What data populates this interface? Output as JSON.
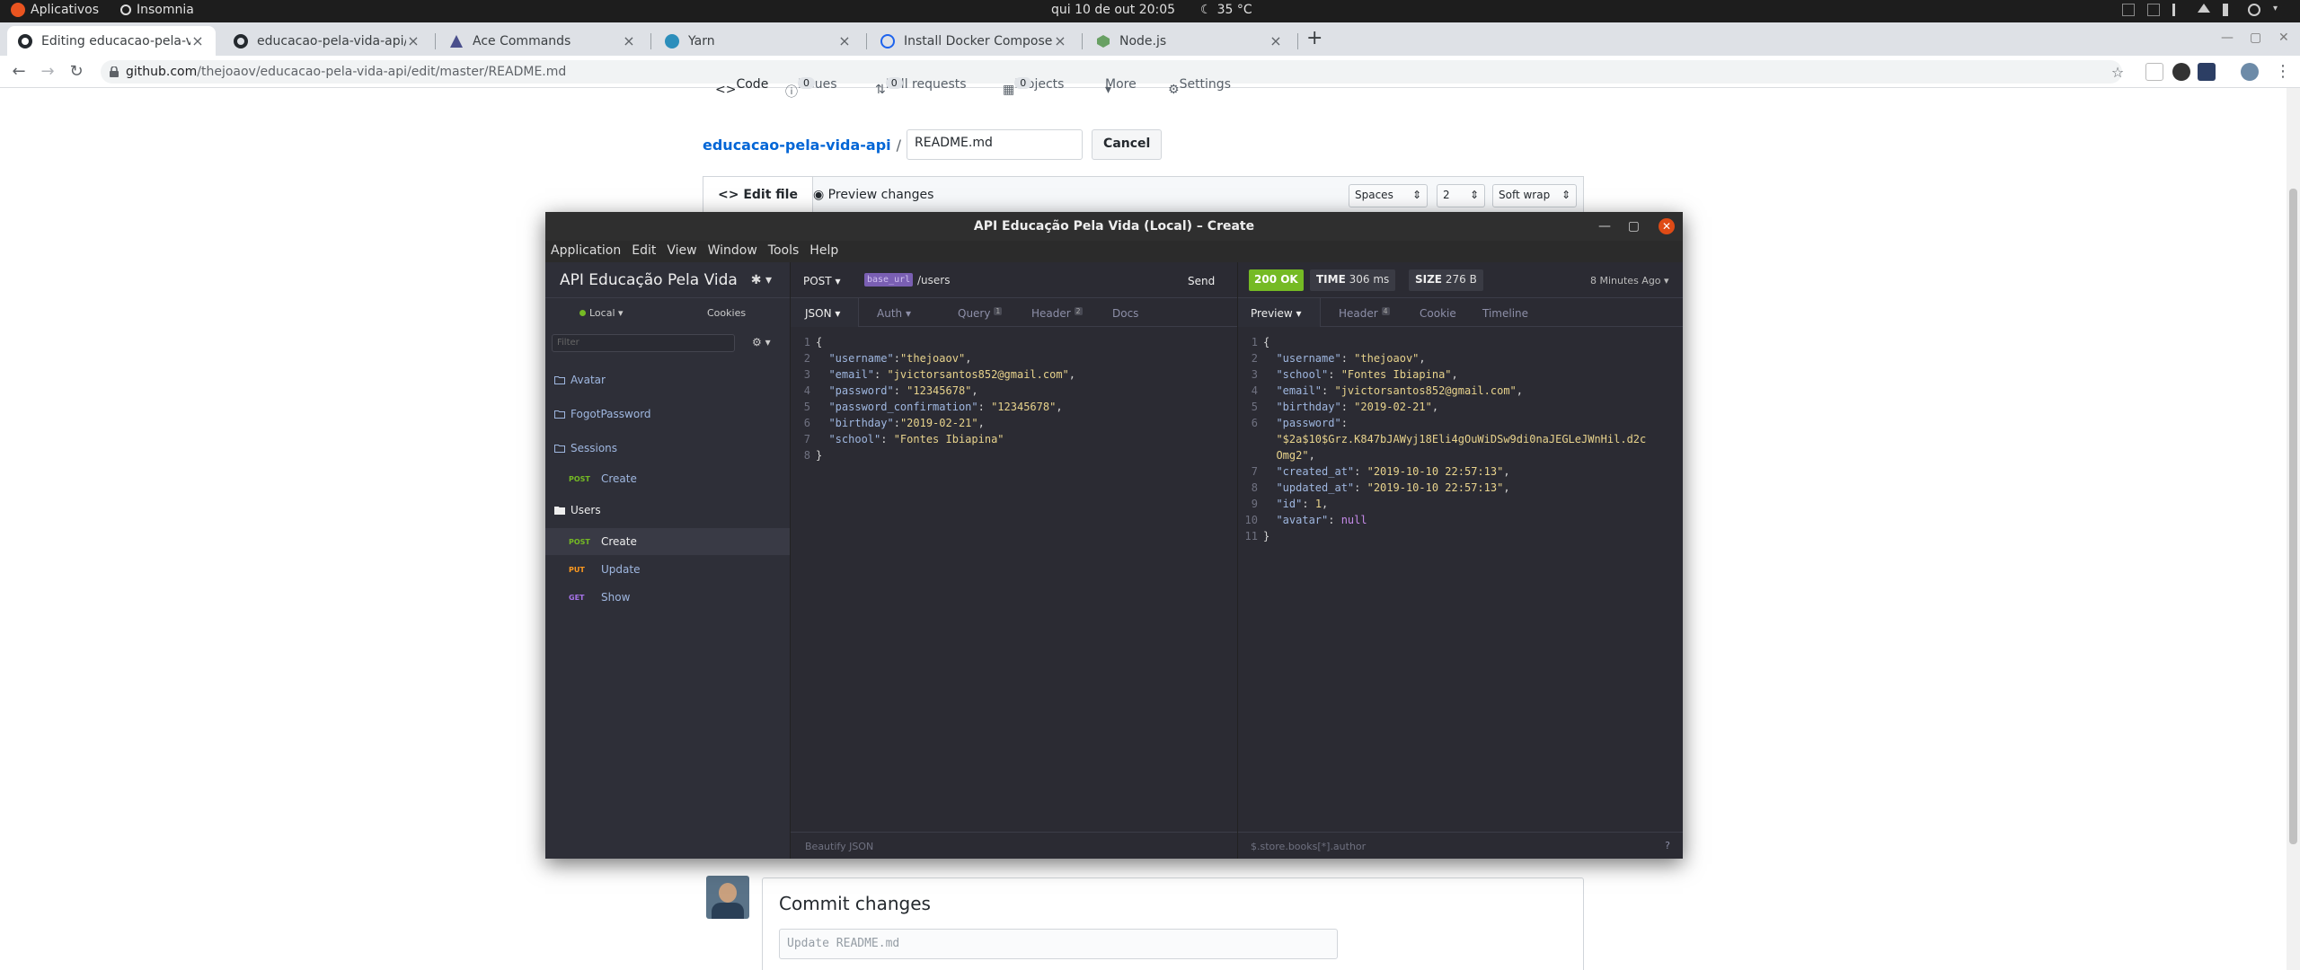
{
  "topbar": {
    "apps_label": "Aplicativos",
    "app_name": "Insomnia",
    "datetime": "qui 10 de out  20:05",
    "weather": "35 °C"
  },
  "browser": {
    "tabs": [
      {
        "title": "Editing educacao-pela-vida-api/README.md",
        "favicon": "github-icon"
      },
      {
        "title": "educacao-pela-vida-api/index.js",
        "favicon": "github-icon"
      },
      {
        "title": "Ace Commands",
        "favicon": "ace-icon"
      },
      {
        "title": "Yarn",
        "favicon": "yarn-icon"
      },
      {
        "title": "Install Docker Compose | Docker Documentation",
        "favicon": "docker-icon"
      },
      {
        "title": "Node.js",
        "favicon": "node-icon"
      }
    ],
    "url_host": "github.com",
    "url_path": "/thejoaov/educacao-pela-vida-api/edit/master/README.md"
  },
  "github": {
    "nav": {
      "code": "Code",
      "issues": "Issues",
      "issues_count": "0",
      "pulls": "Pull requests",
      "pulls_count": "0",
      "projects": "Projects",
      "projects_count": "0",
      "more": "More",
      "settings": "Settings"
    },
    "repo_name": "educacao-pela-vida-api",
    "path_sep": "/",
    "filename": "README.md",
    "cancel_label": "Cancel",
    "edit_tab": "Edit file",
    "preview_tab": "Preview changes",
    "indent_mode": "Spaces",
    "indent_size": "2",
    "wrap_mode": "Soft wrap",
    "commit_title": "Commit changes",
    "commit_placeholder": "Update README.md"
  },
  "insomnia": {
    "window_title": "API Educação Pela Vida (Local) – Create",
    "menu": [
      "Application",
      "Edit",
      "View",
      "Window",
      "Tools",
      "Help"
    ],
    "workspace": "API Educação Pela Vida",
    "environment": "Local",
    "cookies_label": "Cookies",
    "filter_placeholder": "Filter",
    "sidebar": {
      "avatar": "Avatar",
      "forgot": "FogotPassword",
      "sessions": "Sessions",
      "sessions_create_method": "POST",
      "sessions_create": "Create",
      "users": "Users",
      "users_create_method": "POST",
      "users_create": "Create",
      "users_update_method": "PUT",
      "users_update": "Update",
      "users_show_method": "GET",
      "users_show": "Show"
    },
    "request": {
      "method": "POST",
      "base_url_tag": "base_url",
      "path": "/users",
      "send_label": "Send",
      "tabs": {
        "body": "JSON",
        "auth": "Auth",
        "query": "Query",
        "query_count": "1",
        "header": "Header",
        "header_count": "2",
        "docs": "Docs"
      },
      "footer": "Beautify JSON",
      "body": [
        {
          "n": "1",
          "t": "{"
        },
        {
          "n": "2",
          "k": "\"username\"",
          "sep": ":",
          "v": "\"thejoaov\"",
          "end": ","
        },
        {
          "n": "3",
          "k": "\"email\"",
          "sep": ": ",
          "v": "\"jvictorsantos852@gmail.com\"",
          "end": ","
        },
        {
          "n": "4",
          "k": "\"password\"",
          "sep": ": ",
          "v": "\"12345678\"",
          "end": ","
        },
        {
          "n": "5",
          "k": "\"password_confirmation\"",
          "sep": ": ",
          "v": "\"12345678\"",
          "end": ","
        },
        {
          "n": "6",
          "k": "\"birthday\"",
          "sep": ":",
          "v": "\"2019-02-21\"",
          "end": ","
        },
        {
          "n": "7",
          "k": "\"school\"",
          "sep": ": ",
          "v": "\"Fontes Ibiapina\"",
          "end": ""
        },
        {
          "n": "8",
          "t": "}"
        }
      ]
    },
    "response": {
      "status": "200 OK",
      "time_label": "TIME",
      "time_value": "306 ms",
      "size_label": "SIZE",
      "size_value": "276 B",
      "when": "8 Minutes Ago",
      "tabs": {
        "preview": "Preview",
        "header": "Header",
        "header_count": "4",
        "cookie": "Cookie",
        "timeline": "Timeline"
      },
      "footer_filter": "$.store.books[*].author",
      "body": [
        {
          "n": "1",
          "t": "{"
        },
        {
          "n": "2",
          "k": "\"username\"",
          "sep": ": ",
          "v": "\"thejoaov\"",
          "end": ","
        },
        {
          "n": "3",
          "k": "\"school\"",
          "sep": ": ",
          "v": "\"Fontes Ibiapina\"",
          "end": ","
        },
        {
          "n": "4",
          "k": "\"email\"",
          "sep": ": ",
          "v": "\"jvictorsantos852@gmail.com\"",
          "end": ","
        },
        {
          "n": "5",
          "k": "\"birthday\"",
          "sep": ": ",
          "v": "\"2019-02-21\"",
          "end": ","
        },
        {
          "n": "6",
          "k": "\"password\"",
          "sep": ":",
          "v": "",
          "end": ""
        },
        {
          "n": "",
          "v": "\"$2a$10$Grz.K847bJAWyj18Eli4gOuWiDSw9di0naJEGLeJWnHil.d2c",
          "end": ""
        },
        {
          "n": "",
          "v": "Omg2\"",
          "end": ","
        },
        {
          "n": "7",
          "k": "\"created_at\"",
          "sep": ": ",
          "v": "\"2019-10-10 22:57:13\"",
          "end": ","
        },
        {
          "n": "8",
          "k": "\"updated_at\"",
          "sep": ": ",
          "v": "\"2019-10-10 22:57:13\"",
          "end": ","
        },
        {
          "n": "9",
          "k": "\"id\"",
          "sep": ": ",
          "v": "1",
          "end": ","
        },
        {
          "n": "10",
          "k": "\"avatar\"",
          "sep": ": ",
          "nullv": "null",
          "end": ""
        },
        {
          "n": "11",
          "t": "}"
        }
      ]
    }
  }
}
